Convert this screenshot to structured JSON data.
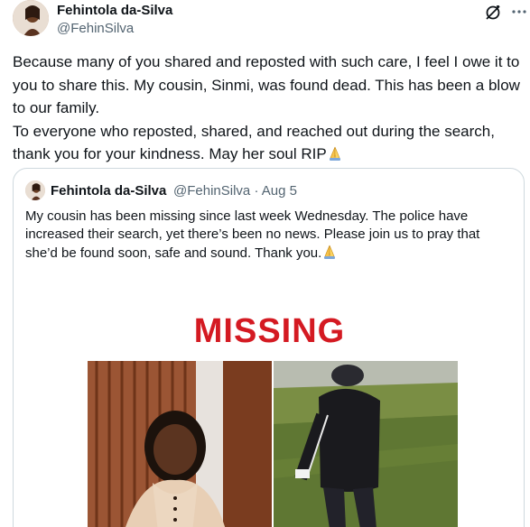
{
  "author": {
    "display_name": "Fehintola da-Silva",
    "handle": "@FehinSilva"
  },
  "tweet": {
    "paragraph_1": "Because many of you shared and reposted with such care, I feel I owe it to you to share this. My cousin, Sinmi, was found dead. This has been a blow to our family.",
    "paragraph_2": "To everyone who reposted, shared, and reached out during the search, thank you for your kindness. May her soul RIP",
    "emoji": "folded-hands-emoji"
  },
  "quoted_tweet": {
    "display_name": "Fehintola da-Silva",
    "handle": "@FehinSilva",
    "separator": "·",
    "date": "Aug 5",
    "text": "My cousin has been missing since last week Wednesday. The police have increased their search, yet there’s been no news. Please join us to pray that she’d be found soon, safe and sound. Thank you.",
    "emoji": "folded-hands-emoji",
    "media": {
      "headline": "MISSING",
      "headline_color": "#d41a22"
    }
  },
  "icons": {
    "grok": "grok-icon",
    "more": "more-options-icon"
  },
  "colors": {
    "text_primary": "#0f1419",
    "text_secondary": "#536471",
    "border": "#cfd9de"
  }
}
